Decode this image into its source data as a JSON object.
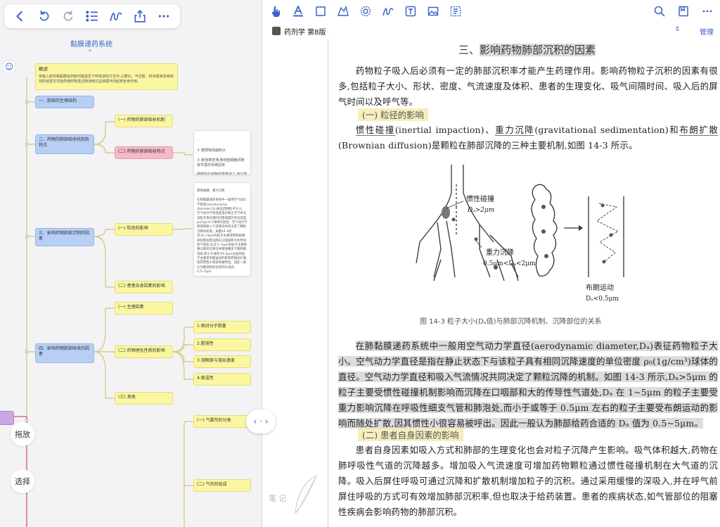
{
  "left_toolbar": {
    "icons": [
      "back-icon",
      "undo-icon",
      "redo-icon",
      "outline-list-icon",
      "draw-icon",
      "share-icon",
      "more-icon"
    ]
  },
  "mindmap": {
    "title": "黏膜递药系统",
    "root_summary": {
      "title": "概述",
      "text": "将吸入制剂等黏膜给药制剂输送至下呼吸道的方法中,以雾化、气溶胶、粉末或液态等制剂的递送方式给药使药物透过肺泡到达血液循环而起到全身作用。"
    },
    "nodes": {
      "n1": "一、肺部的生理结构",
      "n2": "二、药物的肺部吸收机制及特点",
      "n2a": "(一) 药物的肺部吸收机制",
      "n2b": "(二) 药物的肺部吸收特点",
      "note1": "① 肺部吸收面积大\n\n② 肺泡表皮薄,肺泡壁细胞间隙有丰富的毛细血管\n\n肺部的代谢酶较胃肠道少,首过效应较低\n\n③ 药物可直接到达肺部",
      "n3": "三、影响药物肺部沉积的因素",
      "n3a": "(一) 粒径的影响",
      "note2": "惯性碰撞、重力沉降\n\n在肺黏膜递药系统中一般用空气动力学直径(aerodynamic diameter,Dₐ)表征药物粒子大小。空气动力学直径是指在静止空气中与该粒子具有相同沉降速度的单位密度ρ₀(1g/cm³)球体的直径。空气动力学直径和吸入气流情况共同决定了颗粒沉降的机制。如图14-3所示,Dₐ>5μm的粒子主要受惯性碰撞机制影响而沉降在口咽部和大的传导性气道处,Dₐ在1~5μm的粒子主要受重力影响沉降在呼吸性细支气管和肺泡处,而小于或等于0.5μm左右的粒子主要受布朗运动的影响而随处扩散,因其惯性小很容易被呼出。因此一般认为肺部给药合适的Dₐ值为0.5~5μm",
      "n3b": "(二) 患者自身因素的影响",
      "n4": "四、影响药物肺部吸收的因素",
      "n4a": "(一) 生理因素",
      "n4b": "(二) 药物理化性质的影响",
      "n4b1": "1.相对分子质量",
      "n4b2": "2.脂溶性",
      "n4b3": "3.溶解度与溶出速度",
      "n4b4": "4.吸湿性",
      "n4c": "(三) 其他",
      "n5a": "(一) 气雾剂的分类",
      "n5b": "(二) 气剂的组成"
    },
    "side_buttons": {
      "drag": "拖放",
      "select": "选择"
    }
  },
  "right_toolbar": {
    "icons": [
      "pointer-icon",
      "text-highlight-icon",
      "rectangle-select-icon",
      "lasso-icon",
      "settings-icon",
      "pen-icon",
      "text-box-icon",
      "image-icon",
      "text-select-icon"
    ],
    "right_icons": [
      "search-icon",
      "bookmark-icon",
      "more-icon"
    ]
  },
  "document": {
    "book_title": "药剂学 第8版",
    "manage_label": "管理",
    "section_heading_prefix": "三、",
    "section_heading": "影响药物肺部沉积的因素",
    "intro": "药物粒子吸入后必须有一定的肺部沉积率才能产生药理作用。影响药物粒子沉积的因素有很多,包括粒子大小、形状、密度、气流速度及体积、患者的生理变化、吸气间隔时间、吸入后的屏气时间以及呼气等。",
    "sub1": "(一) 粒径的影响",
    "para1_a": "惯性碰撞",
    "para1_b": "(inertial impaction)、",
    "para1_c": "重力沉降",
    "para1_d": "(gravitational sedimentation)和",
    "para1_e": "布朗扩散",
    "para1_f": "(Brownian diffusion)是颗粒在肺部沉降的三种主要机制,如图 14-3 所示。",
    "figure_labels": {
      "impaction": "惯性碰撞",
      "impaction_size": "Dₐ>2μm",
      "sedimentation": "重力沉降",
      "sedimentation_size": "0.5μm<Dₐ<2μm",
      "brownian": "布朗运动",
      "brownian_size": "Dₐ<0.5μm"
    },
    "figure_caption": "图 14-3   粒子大小(Dₐ值)与肺部沉降机制、沉降部位的关系",
    "para2": "在肺黏膜递药系统中一般用空气动力学直径(aerodynamic diameter,Dₐ)表征药物粒子大小。空气动力学直径是指在静止状态下与该粒子具有相同沉降速度的单位密度 ρ₀(1g/cm³)球体的直径。空气动力学直径和吸入气流情况共同决定了颗粒沉降的机制。如图 14-3 所示,Dₐ>5μm 的粒子主要受惯性碰撞机制影响而沉降在口咽部和大的传导性气道处,Dₐ 在 1~5μm 的粒子主要受重力影响沉降在呼吸性细支气管和肺泡处,而小于或等于 0.5μm 左右的粒子主要受布朗运动的影响而随处扩散,因其惯性小很容易被呼出。因此一般认为肺部给药合适的 Dₐ 值为 0.5~5μm。",
    "sub2": "(二) 患者自身因素的影响",
    "para3": "患者自身因素如吸入方式和肺部的生理变化也会对粒子沉降产生影响。吸气体积越大,药物在肺呼吸性气道的沉降越多。增加吸入气流速度可增加药物颗粒通过惯性碰撞机制在大气道的沉降。吸入后屏住呼吸可通过沉降和扩散机制增加粒子的沉积。通过采用缓慢的深吸入,并在呼气前屏住呼吸的方式可有效增加肺部沉积率,但也取决于给药装置。患者的疾病状态,如气管部位的阻塞性疾病会影响药物的肺部沉积。",
    "notes_watermark": "笔 记"
  }
}
